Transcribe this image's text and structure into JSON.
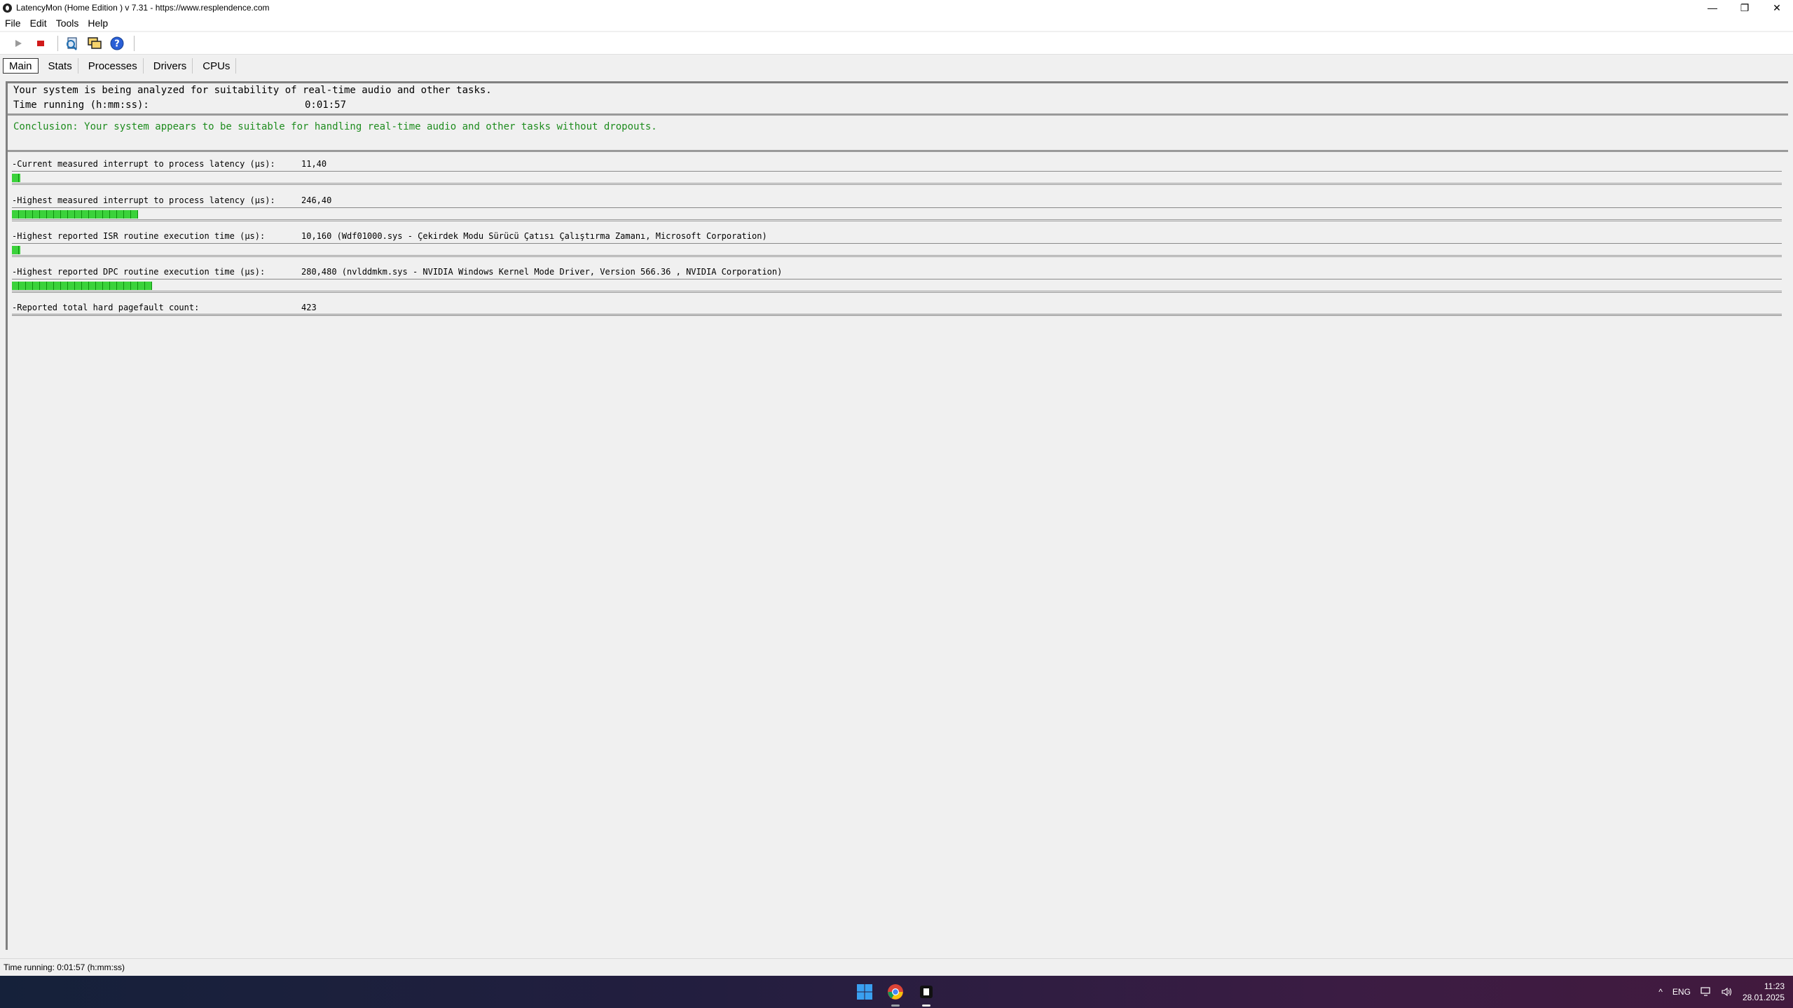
{
  "window": {
    "title": "LatencyMon  (Home Edition )  v 7.31 - https://www.resplendence.com",
    "controls": [
      "—",
      "❐",
      "✕"
    ]
  },
  "menu": [
    {
      "label": "File"
    },
    {
      "label": "Edit"
    },
    {
      "label": "Tools"
    },
    {
      "label": "Help"
    }
  ],
  "toolbar": {
    "icons": [
      "play-icon",
      "stop-icon",
      "report-icon",
      "windows-icon",
      "help-icon"
    ],
    "colors": {
      "stop": "#d11a1a",
      "help": "#2a5fd6",
      "accent_green": "#3bd23b"
    }
  },
  "tabs": [
    {
      "label": "Main",
      "active": true
    },
    {
      "label": "Stats"
    },
    {
      "label": "Processes"
    },
    {
      "label": "Drivers"
    },
    {
      "label": "CPUs"
    }
  ],
  "main": {
    "analysis_text": "Your system is being analyzed for suitability of real-time audio and other tasks.",
    "time_label": "Time running (h:mm:ss):",
    "time_value": "0:01:57",
    "conclusion": "Conclusion: Your system appears to be suitable for handling real-time audio and other tasks without dropouts.",
    "conclusion_color": "#1e8c1e",
    "metrics": [
      {
        "label": "-Current measured interrupt to process latency (µs):",
        "value": "11,40",
        "bar_fraction": 0.003
      },
      {
        "label": "-Highest measured interrupt to process latency (µs):",
        "value": "246,40",
        "bar_fraction": 0.071
      },
      {
        "label": "-Highest reported ISR routine execution time (µs):",
        "value": "10,160  (Wdf01000.sys - Çekirdek Modu Sürücü Çatısı Çalıştırma Zamanı, Microsoft Corporation)",
        "bar_fraction": 0.003
      },
      {
        "label": "-Highest reported DPC routine execution time (µs):",
        "value": "280,480  (nvlddmkm.sys - NVIDIA Windows Kernel Mode Driver, Version 566.36 , NVIDIA Corporation)",
        "bar_fraction": 0.08
      },
      {
        "label": "-Reported total hard pagefault count:",
        "value": "423",
        "bar_fraction": null
      }
    ]
  },
  "status_bar": {
    "text": "Time running: 0:01:57  (h:mm:ss)"
  },
  "taskbar": {
    "apps": [
      "windows-start-icon",
      "chrome-icon",
      "latencymon-icon"
    ],
    "tray": {
      "chevron": "^",
      "language": "ENG",
      "time": "11:23",
      "date": "28.01.2025"
    }
  }
}
